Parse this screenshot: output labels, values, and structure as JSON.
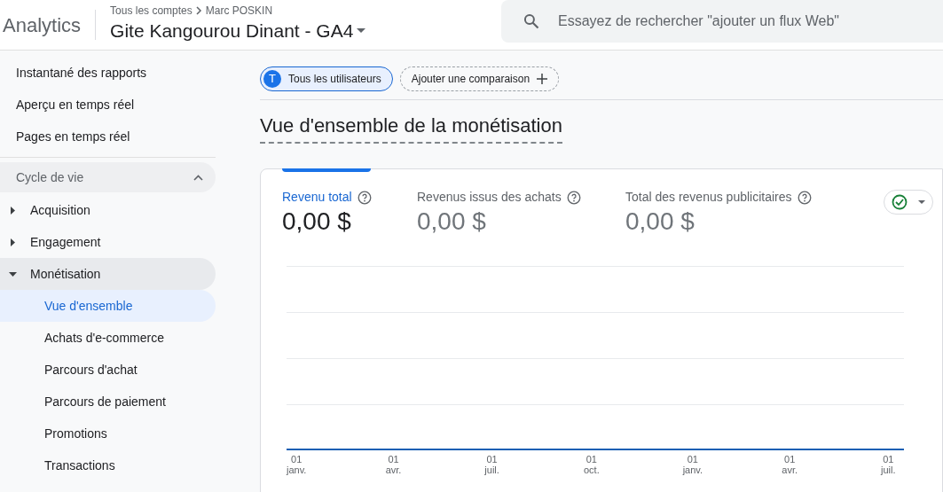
{
  "header": {
    "product": "Analytics",
    "breadcrumb": [
      "Tous les comptes",
      "Marc POSKIN"
    ],
    "property": "Gite Kangourou Dinant - GA4",
    "search": {
      "placeholder": "Essayez de rechercher \"ajouter un flux Web\""
    }
  },
  "sidebar": {
    "items": [
      {
        "label": "Instantané des rapports",
        "selected": false
      },
      {
        "label": "Aperçu en temps réel",
        "selected": false
      },
      {
        "label": "Pages en temps réel",
        "selected": false
      }
    ],
    "section": {
      "label": "Cycle de vie",
      "expanded": true
    },
    "tree": [
      {
        "label": "Acquisition",
        "expanded": false,
        "selected": false
      },
      {
        "label": "Engagement",
        "expanded": false,
        "selected": false
      },
      {
        "label": "Monétisation",
        "expanded": true,
        "selected": false,
        "children": [
          {
            "label": "Vue d'ensemble",
            "selected": true
          },
          {
            "label": "Achats d'e-commerce",
            "selected": false
          },
          {
            "label": "Parcours d'achat",
            "selected": false
          },
          {
            "label": "Parcours de paiement",
            "selected": false
          },
          {
            "label": "Promotions",
            "selected": false
          },
          {
            "label": "Transactions",
            "selected": false
          }
        ]
      }
    ]
  },
  "comparison": {
    "segment": {
      "initial": "T",
      "label": "Tous les utilisateurs"
    },
    "add": "Ajouter une comparaison"
  },
  "page_title": "Vue d'ensemble de la monétisation",
  "metrics": [
    {
      "label": "Revenu total",
      "value": "0,00 $",
      "selected": true
    },
    {
      "label": "Revenus issus des achats",
      "value": "0,00 $",
      "selected": false
    },
    {
      "label": "Total des revenus publicitaires",
      "value": "0,00 $",
      "selected": false
    }
  ],
  "x_axis_labels": [
    {
      "day": "01",
      "month": "janv."
    },
    {
      "day": "01",
      "month": "avr."
    },
    {
      "day": "01",
      "month": "juil."
    },
    {
      "day": "01",
      "month": "oct."
    },
    {
      "day": "01",
      "month": "janv."
    },
    {
      "day": "01",
      "month": "avr."
    },
    {
      "day": "01",
      "month": "juil."
    }
  ]
}
